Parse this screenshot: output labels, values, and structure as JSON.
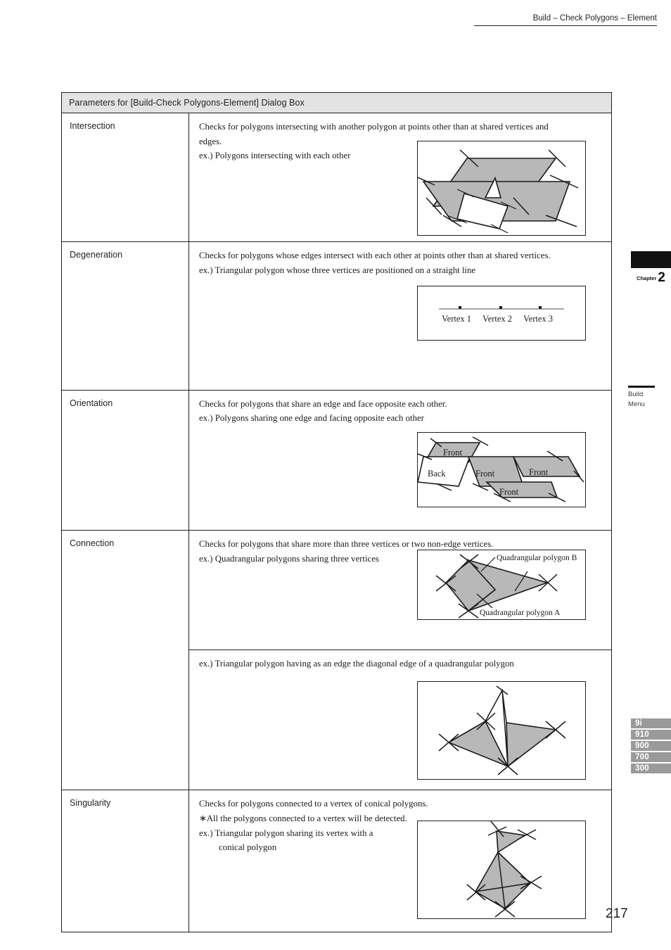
{
  "header": {
    "running_head": "Build – Check Polygons – Element"
  },
  "table": {
    "caption": "Parameters for [Build-Check Polygons-Element] Dialog Box",
    "rows": [
      {
        "term": "Intersection",
        "lines": [
          "Checks for polygons intersecting with another polygon at points other than at shared vertices and",
          "edges.",
          "ex.) Polygons intersecting with each other"
        ],
        "figure": "intersection-figure"
      },
      {
        "term": "Degeneration",
        "lines": [
          "Checks for polygons whose edges intersect with each other at points other than at shared vertices.",
          "ex.) Triangular polygon whose three vertices are positioned on a straight line"
        ],
        "figure": "degeneration-figure",
        "figure_labels": [
          "Vertex 1",
          "Vertex 2",
          "Vertex 3"
        ]
      },
      {
        "term": "Orientation",
        "lines": [
          "Checks for polygons that share an edge and face opposite each other.",
          "ex.) Polygons sharing one edge and facing opposite each other"
        ],
        "figure": "orientation-figure",
        "figure_labels": [
          "Front",
          "Back",
          "Front",
          "Front",
          "Front"
        ]
      },
      {
        "term": "Connection",
        "lines": [
          "Checks for polygons that share more than three vertices or two non-edge vertices.",
          "ex.) Quadrangular polygons sharing three vertices"
        ],
        "figure": "connection-figure-a",
        "figure_labels": [
          "Quadrangular polygon B",
          "Quadrangular polygon A"
        ]
      },
      {
        "term": "",
        "lines": [
          "ex.) Triangular polygon having as an edge the diagonal edge of a quadrangular polygon"
        ],
        "figure": "connection-figure-b"
      },
      {
        "term": "Singularity",
        "lines": [
          "Checks for polygons connected to a vertex of conical polygons.",
          "∗All the polygons connected to a vertex will be detected.",
          "ex.) Triangular polygon sharing its vertex with a",
          "conical polygon"
        ],
        "figure": "singularity-figure"
      }
    ]
  },
  "margin": {
    "chapter_word": "Chapter",
    "chapter_number": "2",
    "menu_line1": "Build",
    "menu_line2": "Menu",
    "model_tabs": [
      "9i",
      "910",
      "900",
      "700",
      "300"
    ]
  },
  "footer": {
    "page_number": "217"
  },
  "colors": {
    "polygon_fill": "#b8b8b8",
    "header_band": "#e3e3e3",
    "model_tab": "#9a9a9a",
    "rule": "#231f20"
  }
}
